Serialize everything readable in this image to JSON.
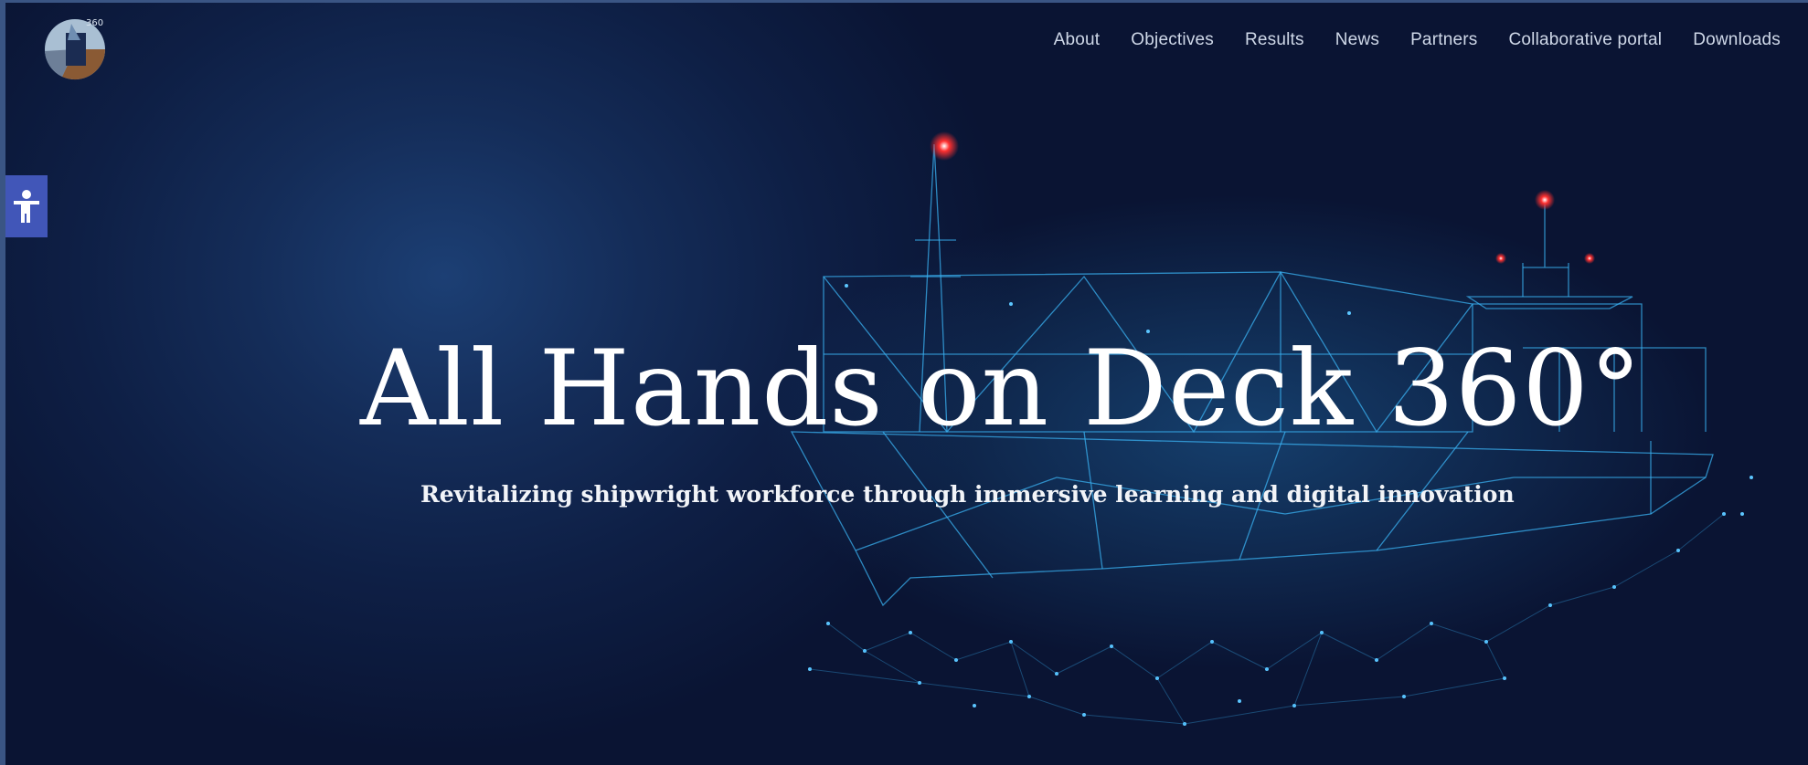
{
  "brand": {
    "logo_icon": "ahod-360-logo-icon",
    "logo_text": "360"
  },
  "nav": {
    "items": [
      {
        "label": "About"
      },
      {
        "label": "Objectives"
      },
      {
        "label": "Results"
      },
      {
        "label": "News"
      },
      {
        "label": "Partners"
      },
      {
        "label": "Collaborative portal"
      },
      {
        "label": "Downloads"
      }
    ]
  },
  "accessibility": {
    "icon": "accessibility-person-icon"
  },
  "hero": {
    "title": "All Hands on Deck 360°",
    "subtitle": "Revitalizing shipwright workforce through immersive learning and digital innovation",
    "illustration": "wireframe-ship-illustration"
  },
  "colors": {
    "background": "#0e1f45",
    "nav_text": "#cfd8e8",
    "accessibility_button": "#4156b8",
    "ship_wire": "#2fa4e7",
    "mast_light": "#ff2a2a"
  }
}
